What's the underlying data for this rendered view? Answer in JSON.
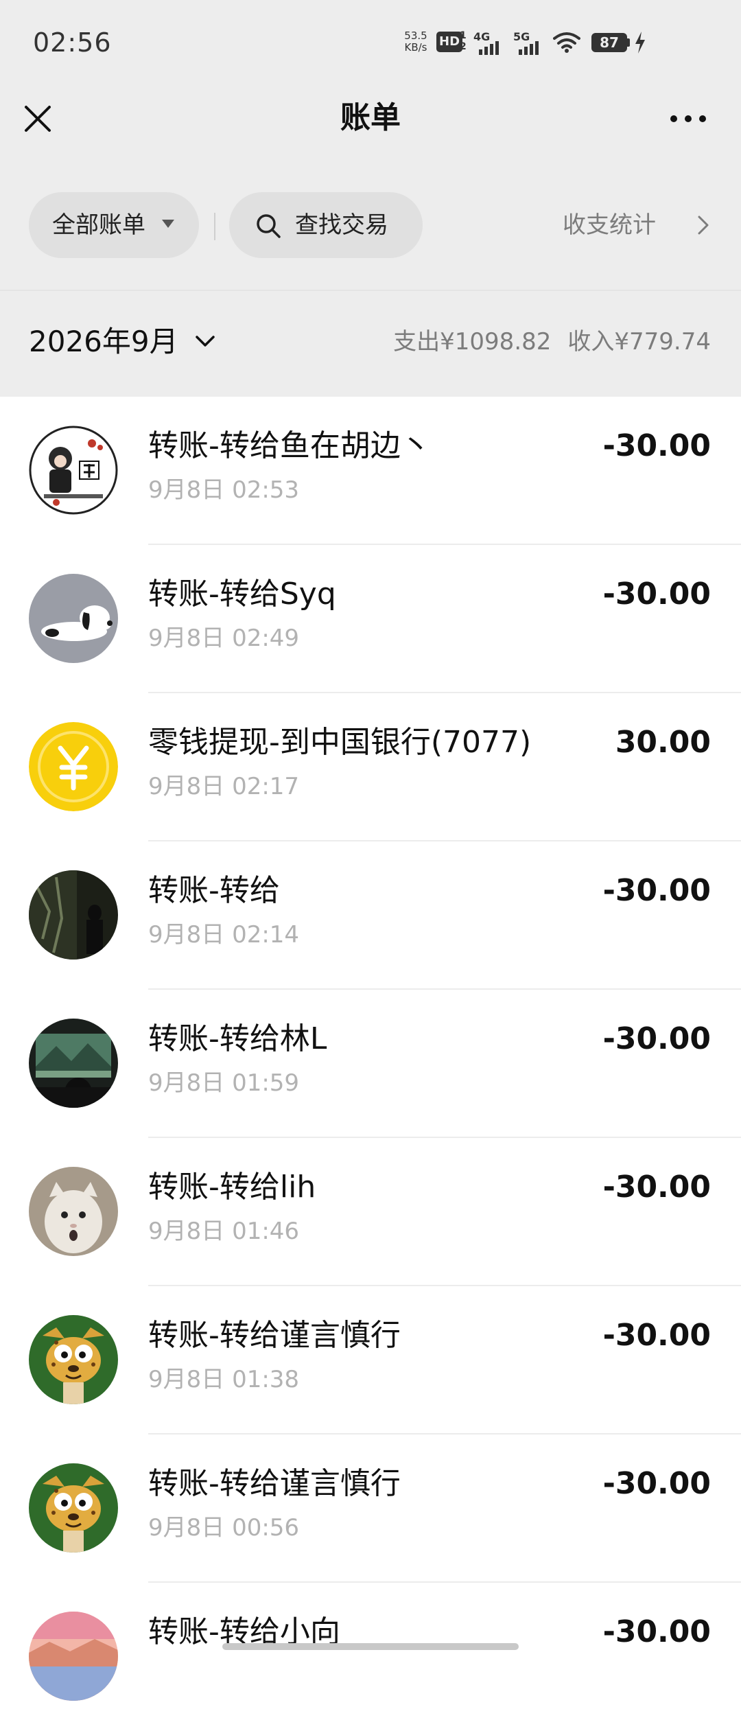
{
  "status_bar": {
    "time": "02:56",
    "net_speed_value": "53.5",
    "net_speed_unit": "KB/s",
    "hd_label": "HD",
    "hd_sub_top": "1",
    "hd_sub_bottom": "2",
    "net1_label": "4G",
    "net2_label": "5G",
    "battery_level": "87"
  },
  "header": {
    "title": "账单"
  },
  "filters": {
    "all_bills_label": "全部账单",
    "search_label": "查找交易",
    "stats_label": "收支统计"
  },
  "month": {
    "label": "2026年9月",
    "expense_summary": "支出¥1098.82",
    "income_summary": "收入¥779.74"
  },
  "transactions": [
    {
      "title": "转账-转给鱼在胡边丶",
      "time": "9月8日 02:53",
      "amount": "-30.00",
      "avatar": "hu-calligraphy-avatar"
    },
    {
      "title": "转账-转给Syq",
      "time": "9月8日 02:49",
      "amount": "-30.00",
      "avatar": "snoopy-avatar"
    },
    {
      "title": "零钱提现-到中国银行(7077)",
      "time": "9月8日 02:17",
      "amount": "30.00",
      "avatar": "yuan-coin-icon"
    },
    {
      "title": "转账-转给",
      "time": "9月8日 02:14",
      "amount": "-30.00",
      "avatar": "dark-scene-avatar"
    },
    {
      "title": "转账-转给林L",
      "time": "9月8日 01:59",
      "amount": "-30.00",
      "avatar": "landscape-avatar"
    },
    {
      "title": "转账-转给lih",
      "time": "9月8日 01:46",
      "amount": "-30.00",
      "avatar": "white-cat-avatar"
    },
    {
      "title": "转账-转给谨言慎行",
      "time": "9月8日 01:38",
      "amount": "-30.00",
      "avatar": "cartoon-leopard-avatar"
    },
    {
      "title": "转账-转给谨言慎行",
      "time": "9月8日 00:56",
      "amount": "-30.00",
      "avatar": "cartoon-leopard-avatar"
    },
    {
      "title": "转账-转给小向",
      "time": "",
      "amount": "-30.00",
      "avatar": "sunset-avatar"
    }
  ],
  "colors": {
    "background_top": "#ededed",
    "pill_background": "#e0e0e0",
    "secondary_text": "#7c7c7c",
    "time_text": "#b2b2b2",
    "coin_yellow": "#f8cf0c"
  }
}
